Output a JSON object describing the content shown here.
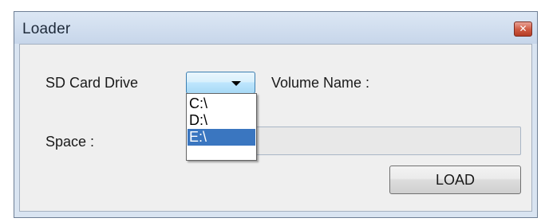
{
  "window": {
    "title": "Loader",
    "close_glyph": "✕"
  },
  "form": {
    "sd_card_drive_label": "SD Card Drive",
    "volume_name_label": "Volume Name :",
    "space_label": "Space :",
    "drive_select_value": "",
    "space_value": "",
    "load_button_label": "LOAD"
  },
  "drive_dropdown": {
    "options": [
      "C:\\",
      "D:\\",
      "E:\\"
    ],
    "highlighted": "E:\\"
  },
  "colors": {
    "selection_highlight": "#3a76c0",
    "close_button": "#c4472f"
  }
}
